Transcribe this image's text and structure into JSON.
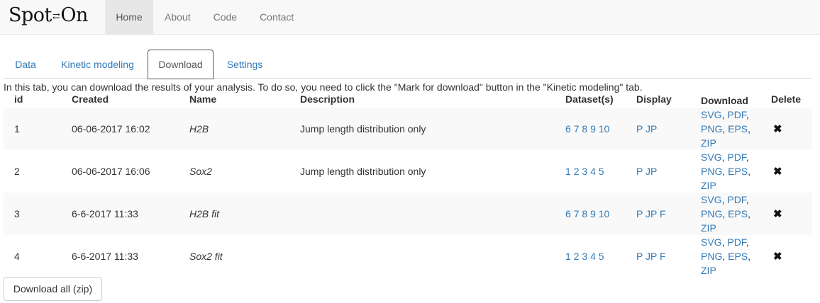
{
  "navbar": {
    "brand_left": "Sp",
    "brand_mid": "⇄",
    "brand_right": "On",
    "brand_o": "o",
    "brand_t": "t",
    "items": [
      {
        "label": "Home",
        "active": true
      },
      {
        "label": "About",
        "active": false
      },
      {
        "label": "Code",
        "active": false
      },
      {
        "label": "Contact",
        "active": false
      }
    ]
  },
  "tabs": [
    {
      "label": "Data",
      "active": false
    },
    {
      "label": "Kinetic modeling",
      "active": false
    },
    {
      "label": "Download",
      "active": true
    },
    {
      "label": "Settings",
      "active": false
    }
  ],
  "intro": "In this tab, you can download the results of your analysis. To do so, you need to click the \"Mark for download\" button in the \"Kinetic modeling\" tab.",
  "table": {
    "headers": {
      "id": "id",
      "created": "Created",
      "name": "Name",
      "description": "Description",
      "datasets": "Dataset(s)",
      "display": "Display",
      "download": "Download",
      "delete": "Delete"
    },
    "rows": [
      {
        "id": "1",
        "created": "06-06-2017 16:02",
        "name": "H2B",
        "description": "Jump length distribution only",
        "datasets": [
          "6",
          "7",
          "8",
          "9",
          "10"
        ],
        "display": [
          "P",
          "JP"
        ]
      },
      {
        "id": "2",
        "created": "06-06-2017 16:06",
        "name": "Sox2",
        "description": "Jump length distribution only",
        "datasets": [
          "1",
          "2",
          "3",
          "4",
          "5"
        ],
        "display": [
          "P",
          "JP"
        ]
      },
      {
        "id": "3",
        "created": "6-6-2017 11:33",
        "name": "H2B fit",
        "description": "",
        "datasets": [
          "6",
          "7",
          "8",
          "9",
          "10"
        ],
        "display": [
          "P",
          "JP",
          "F"
        ]
      },
      {
        "id": "4",
        "created": "6-6-2017 11:33",
        "name": "Sox2 fit",
        "description": "",
        "datasets": [
          "1",
          "2",
          "3",
          "4",
          "5"
        ],
        "display": [
          "P",
          "JP",
          "F"
        ]
      }
    ],
    "download_formats": [
      "SVG",
      "PDF",
      "PNG",
      "EPS",
      "ZIP"
    ],
    "delete_glyph": "✖"
  },
  "download_all_label": "Download all (zip)"
}
